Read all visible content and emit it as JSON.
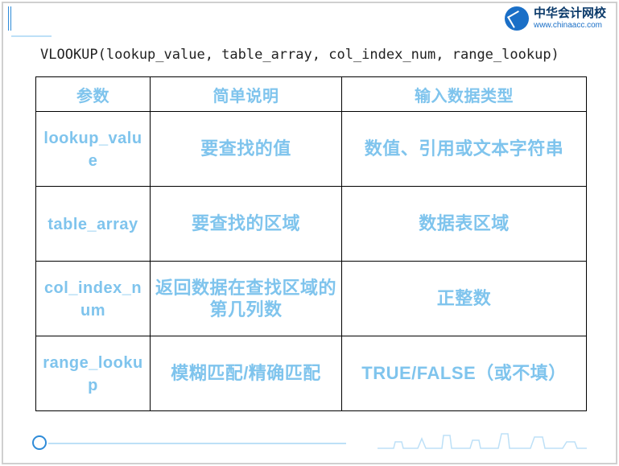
{
  "brand": {
    "name_cn": "中华会计网校",
    "url": "www.chinaacc.com"
  },
  "syntax": "VLOOKUP(lookup_value,  table_array,   col_index_num,  range_lookup)",
  "table": {
    "header": {
      "param": "参数",
      "desc": "简单说明",
      "type": "输入数据类型"
    },
    "rows": [
      {
        "param": "lookup_value",
        "desc": "要查找的值",
        "type": "数值、引用或文本字符串"
      },
      {
        "param": "table_array",
        "desc": "要查找的区域",
        "type": "数据表区域"
      },
      {
        "param": "col_index_num",
        "desc": "返回数据在查找区域的第几列数",
        "type": "正整数"
      },
      {
        "param": "range_lookup",
        "desc": "模糊匹配/精确匹配",
        "type": "TRUE/FALSE（或不填）"
      }
    ]
  }
}
